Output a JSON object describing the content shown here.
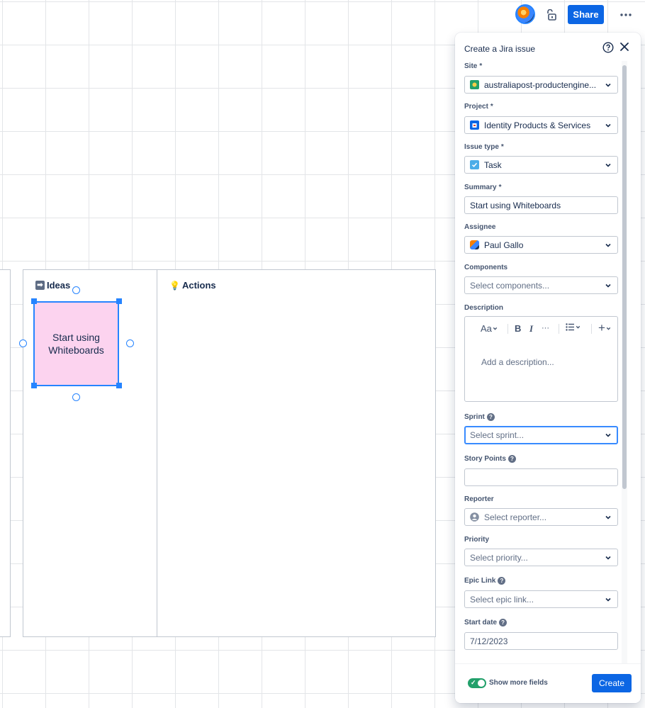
{
  "toolbar": {
    "share_label": "Share",
    "more_label": "···"
  },
  "whiteboard": {
    "columns": [
      {
        "title": "Ideas",
        "icon": "right-arrow-emoji"
      },
      {
        "title": "Actions",
        "icon": "lightbulb-emoji"
      }
    ],
    "sticky": {
      "text": "Start using Whiteboards",
      "color": "#fcd3ef"
    }
  },
  "modal": {
    "title": "Create a Jira issue",
    "required_marker": "*",
    "fields": {
      "site": {
        "label": "Site",
        "value": "australiapost-productengine..."
      },
      "project": {
        "label": "Project",
        "value": "Identity Products & Services"
      },
      "issue_type": {
        "label": "Issue type",
        "value": "Task"
      },
      "summary": {
        "label": "Summary",
        "value": "Start using Whiteboards"
      },
      "assignee": {
        "label": "Assignee",
        "value": "Paul Gallo"
      },
      "components": {
        "label": "Components",
        "placeholder": "Select components..."
      },
      "description": {
        "label": "Description",
        "placeholder": "Add a description..."
      },
      "sprint": {
        "label": "Sprint",
        "placeholder": "Select sprint..."
      },
      "story_points": {
        "label": "Story Points",
        "value": ""
      },
      "reporter": {
        "label": "Reporter",
        "placeholder": "Select reporter..."
      },
      "priority": {
        "label": "Priority",
        "placeholder": "Select priority..."
      },
      "epic_link": {
        "label": "Epic Link",
        "placeholder": "Select epic link..."
      },
      "start_date": {
        "label": "Start date",
        "value": "7/12/2023"
      }
    },
    "editor_toolbar": {
      "text_style": "Aa",
      "bold": "B",
      "italic": "I",
      "more": "···",
      "list": "☰",
      "insert": "+"
    },
    "footer": {
      "toggle_label": "Show more fields",
      "toggle_on": true,
      "create_label": "Create"
    }
  },
  "colors": {
    "primary": "#0c66e4",
    "toggle_on": "#22a06b",
    "selection": "#2684ff"
  }
}
